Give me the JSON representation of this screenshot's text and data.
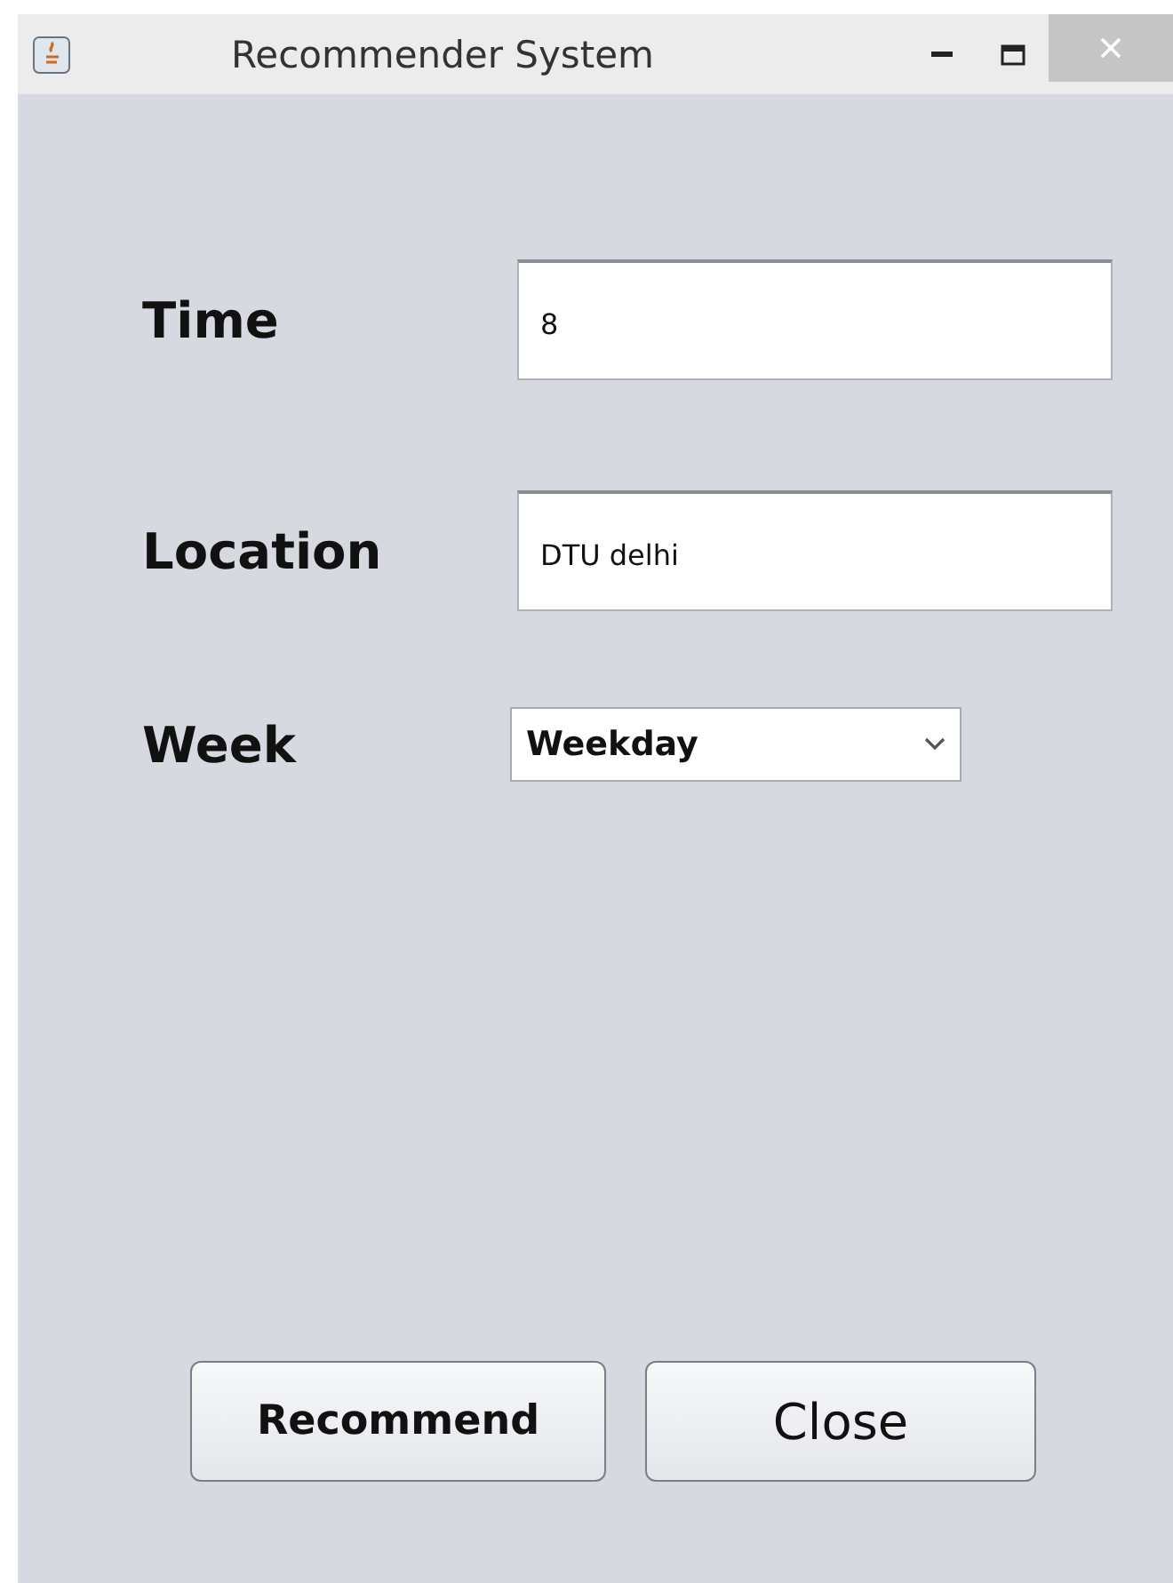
{
  "window": {
    "title": "Recommender System"
  },
  "fields": [
    {
      "kind": "text",
      "label": "Time",
      "value": "8"
    },
    {
      "kind": "text",
      "label": "Location",
      "value": "DTU delhi"
    },
    {
      "kind": "select",
      "label": "Week",
      "value": "Weekday"
    }
  ],
  "buttons": [
    {
      "label": "Recommend",
      "kind": "bold"
    },
    {
      "label": "Close",
      "kind": "plain"
    }
  ]
}
